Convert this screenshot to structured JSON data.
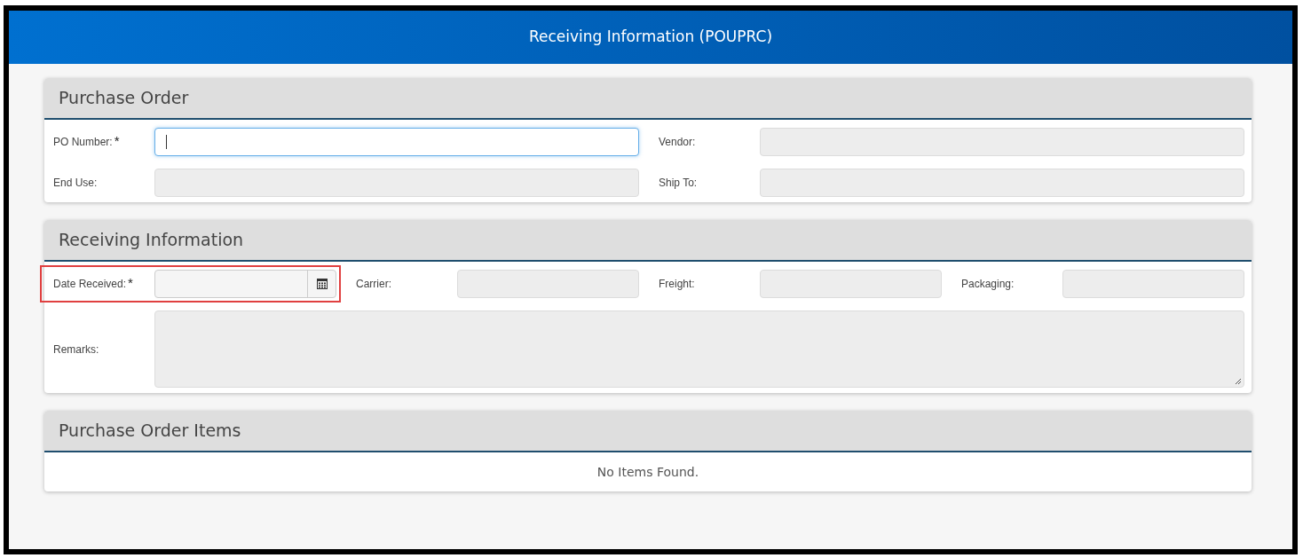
{
  "header": {
    "title": "Receiving Information (POUPRC)"
  },
  "sections": [
    {
      "title": "Purchase Order",
      "kind": "fields",
      "rows": [
        {
          "fields": [
            {
              "label": "PO Number:",
              "required_mark": "*",
              "kind": "text",
              "focused": true,
              "disabled": false
            },
            {
              "label": "Vendor:",
              "kind": "text",
              "focused": false,
              "disabled": true
            }
          ]
        },
        {
          "fields": [
            {
              "label": "End Use:",
              "kind": "text",
              "focused": false,
              "disabled": true
            },
            {
              "label": "Ship To:",
              "kind": "text",
              "focused": false,
              "disabled": true
            }
          ]
        }
      ]
    },
    {
      "title": "Receiving Information",
      "kind": "fields",
      "rows": [
        {
          "fields": [
            {
              "label": "Date Received:",
              "required_mark": "*",
              "kind": "date",
              "focused": false,
              "disabled": false,
              "highlighted": true
            },
            {
              "label": "Carrier:",
              "kind": "text",
              "focused": false,
              "disabled": true
            },
            {
              "label": "Freight:",
              "kind": "text",
              "focused": false,
              "disabled": true
            },
            {
              "label": "Packaging:",
              "kind": "text",
              "focused": false,
              "disabled": true
            }
          ]
        },
        {
          "fields": [
            {
              "label": "Remarks:",
              "kind": "textarea",
              "focused": false,
              "disabled": true
            }
          ]
        }
      ]
    },
    {
      "title": "Purchase Order Items",
      "kind": "message",
      "message": "No Items Found."
    }
  ]
}
